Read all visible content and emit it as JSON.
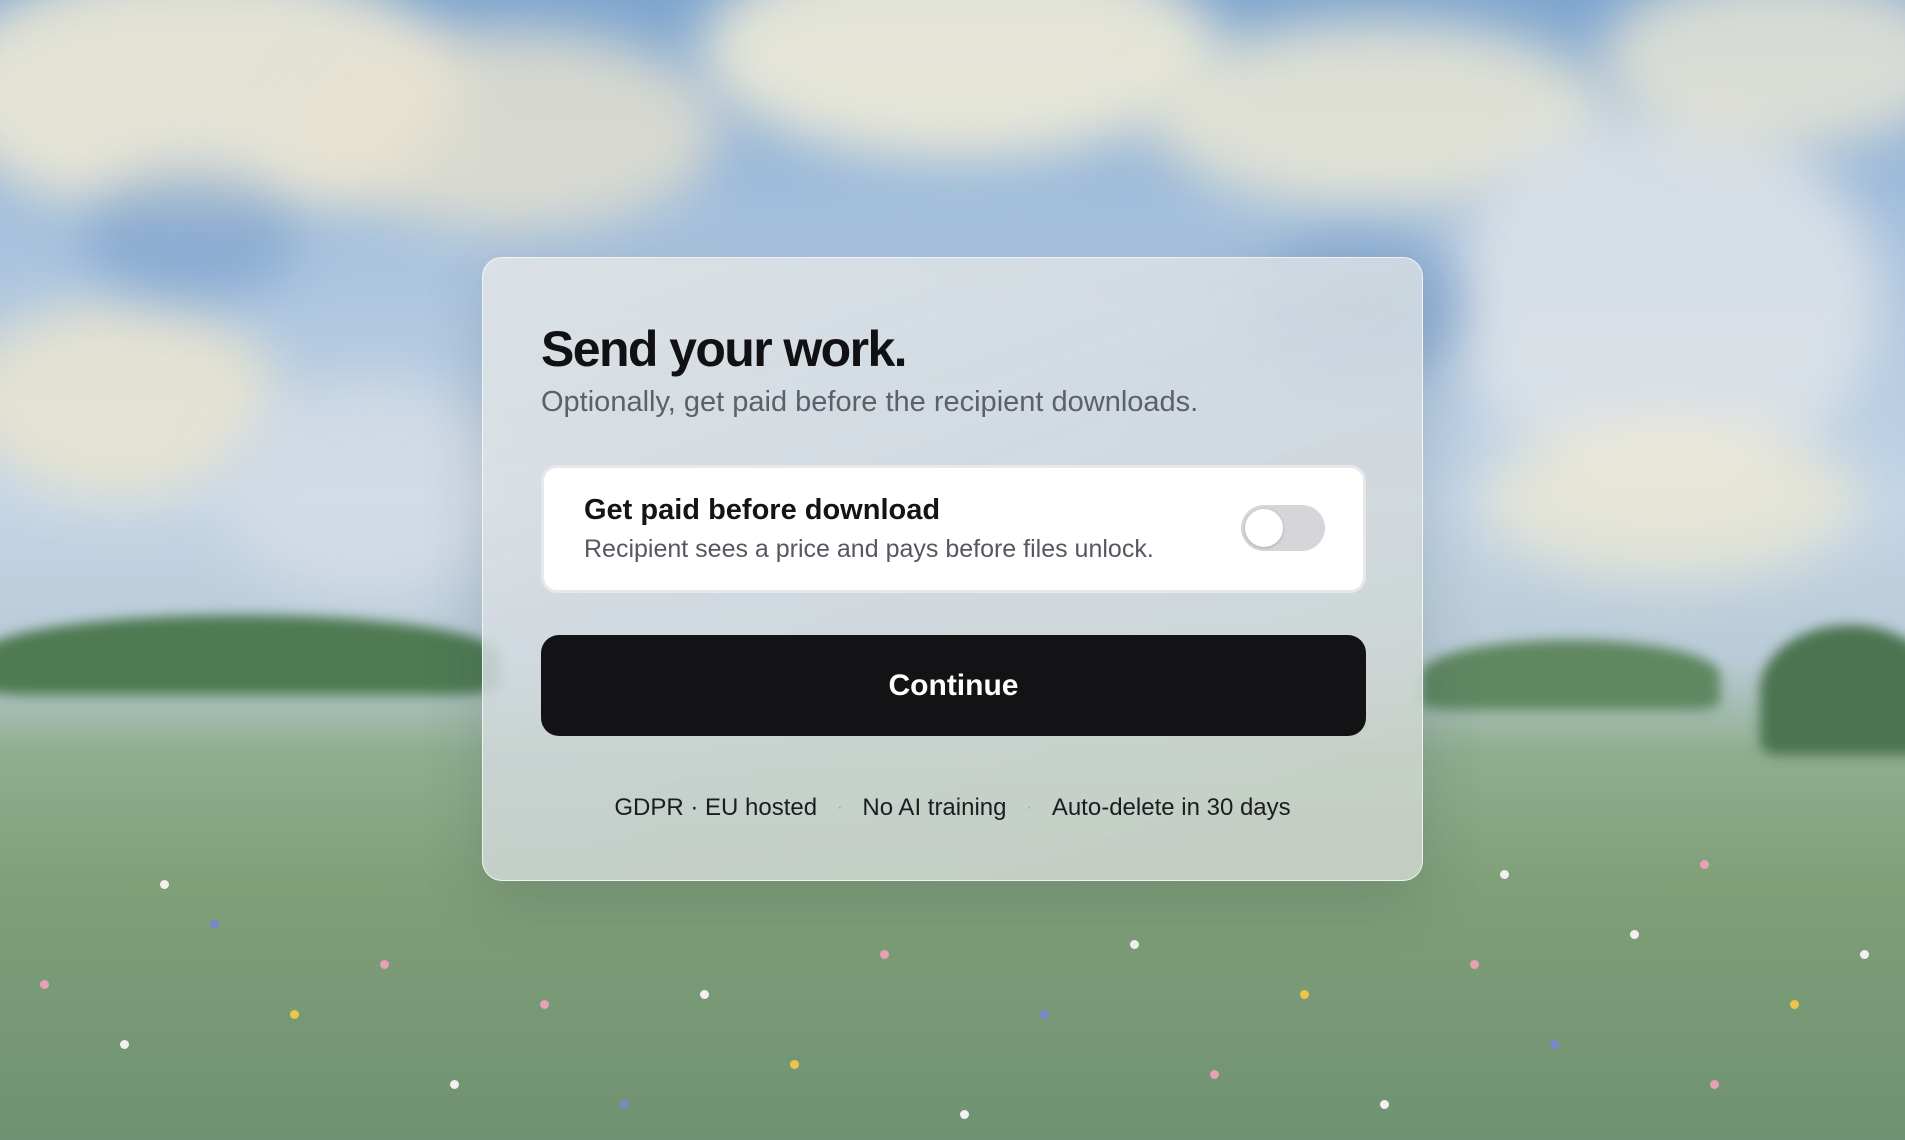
{
  "card": {
    "title": "Send your work.",
    "subtitle": "Optionally, get paid before the recipient downloads."
  },
  "paid_option": {
    "title": "Get paid before download",
    "description": "Recipient sees a price and pays before files unlock.",
    "toggle_on": false
  },
  "actions": {
    "continue_label": "Continue"
  },
  "footer": {
    "items": [
      "GDPR · EU hosted",
      "No AI training",
      "Auto-delete in 30 days"
    ],
    "separator": "·"
  },
  "colors": {
    "primary_button": "#131315",
    "toggle_off": "#d6d6da",
    "subtitle_text": "#5c6068"
  }
}
